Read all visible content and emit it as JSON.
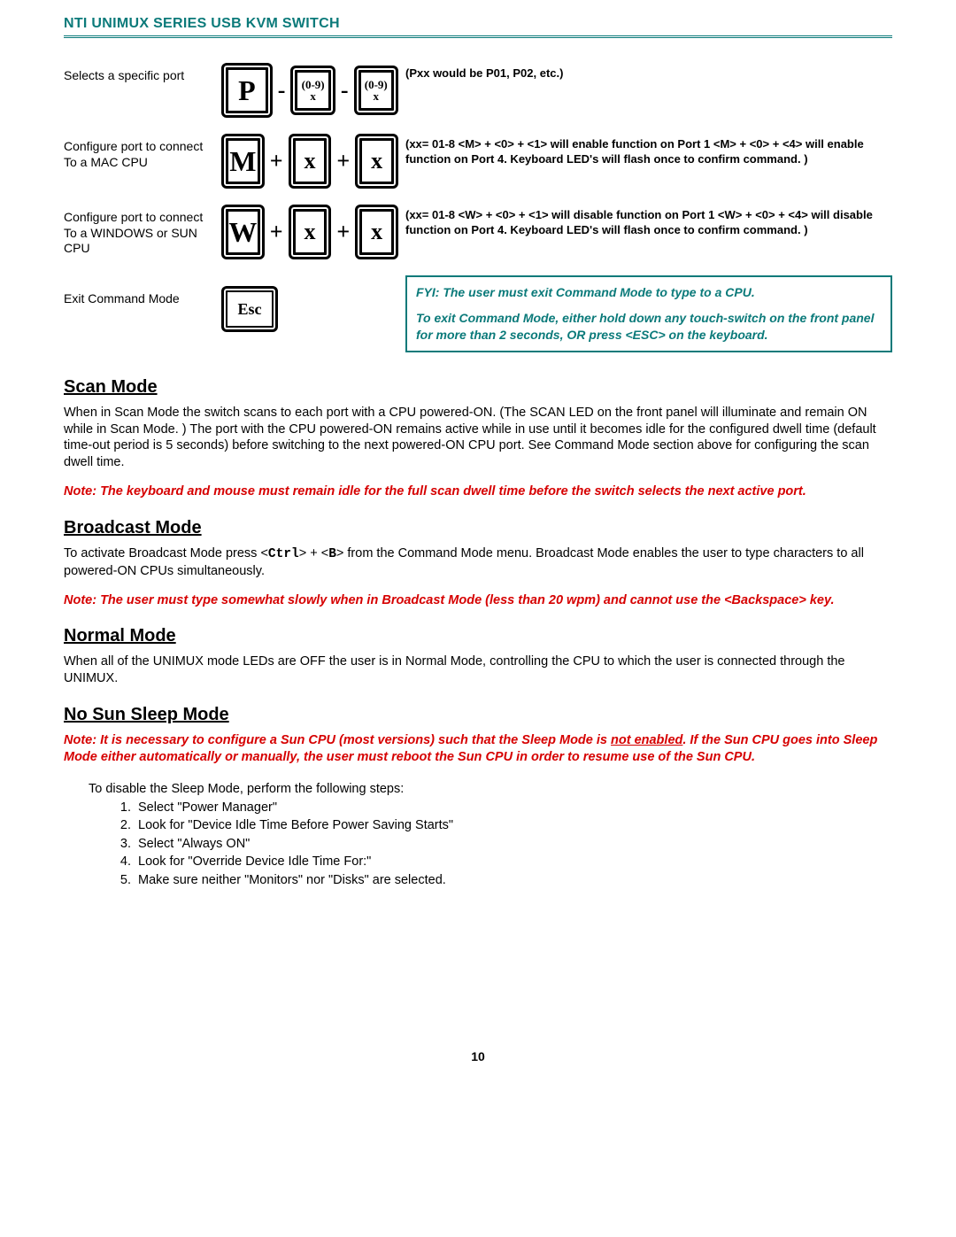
{
  "header": "NTI UNIMUX SERIES USB KVM SWITCH",
  "cmd": {
    "row1": {
      "desc": "Selects a specific port",
      "k1": "P",
      "k2a": "(0-9)",
      "k2b": "x",
      "k3a": "(0-9)",
      "k3b": "x",
      "note": "(Pxx would be P01, P02, etc.)"
    },
    "row2": {
      "desc": "Configure port to connect To a MAC CPU",
      "k1": "M",
      "k2": "x",
      "k3": "x",
      "note": "(xx= 01-8  <M> + <0> + <1> will enable function on Port 1 <M> + <0> + <4> will enable function on Port 4.   Keyboard LED's will flash once to confirm command. )"
    },
    "row3": {
      "desc": "Configure port to connect To a WINDOWS or SUN CPU",
      "k1": "W",
      "k2": "x",
      "k3": "x",
      "note": "(xx= 01-8  <W> + <0> + <1> will disable function on Port 1 <W> + <0> + <4> will disable function on Port 4.   Keyboard LED's will flash once to confirm command. )"
    },
    "row4": {
      "desc": "Exit Command Mode",
      "k1": "Esc",
      "info1": "FYI:  The user must exit Command Mode to type to a CPU.",
      "info2": "To exit Command Mode, either hold down any touch-switch on the front panel for more than 2 seconds, OR  press <ESC> on the keyboard."
    }
  },
  "scan": {
    "h": "Scan Mode",
    "p": "When in Scan Mode the switch scans to each port with a CPU powered-ON. (The SCAN LED on the front panel will illuminate and remain ON while in Scan Mode. ) The port with the CPU powered-ON remains active while in use until it becomes idle for the configured dwell time (default time-out period is 5 seconds) before switching to the next powered-ON CPU port. See Command Mode section above for configuring the scan dwell time.",
    "note": "Note: The keyboard and mouse must remain idle for the full scan dwell time before the switch selects the next active port."
  },
  "broadcast": {
    "h": "Broadcast Mode",
    "p_a": "To activate Broadcast Mode press <",
    "p_ctrl": "Ctrl",
    "p_b": "> + <",
    "p_B": "B",
    "p_c": "> from the Command Mode menu.  Broadcast Mode enables the user to type characters to all powered-ON CPUs simultaneously.",
    "note": "Note:  The user must type somewhat slowly when in Broadcast Mode (less than 20 wpm) and cannot use the <Backspace> key."
  },
  "normal": {
    "h": "Normal Mode",
    "p": "When all of the UNIMUX mode LEDs are OFF the user is in Normal Mode, controlling the CPU to which the user is connected through the UNIMUX."
  },
  "nosun": {
    "h": "No Sun Sleep Mode",
    "note_a": "Note:  It is necessary to configure a Sun CPU (most versions) such that the Sleep Mode is ",
    "note_u": "not enabled",
    "note_b": ".  If the Sun CPU goes into Sleep Mode either automatically or manually, the user must reboot the Sun CPU in order to resume use of the Sun CPU.",
    "intro": "To disable the Sleep Mode, perform the following steps:",
    "steps": [
      "Select \"Power Manager\"",
      "Look for \"Device Idle Time Before Power Saving Starts\"",
      "Select \"Always ON\"",
      "Look for \"Override Device Idle Time For:\"",
      "Make sure neither \"Monitors\" nor \"Disks\" are selected."
    ]
  },
  "pagenum": "10"
}
